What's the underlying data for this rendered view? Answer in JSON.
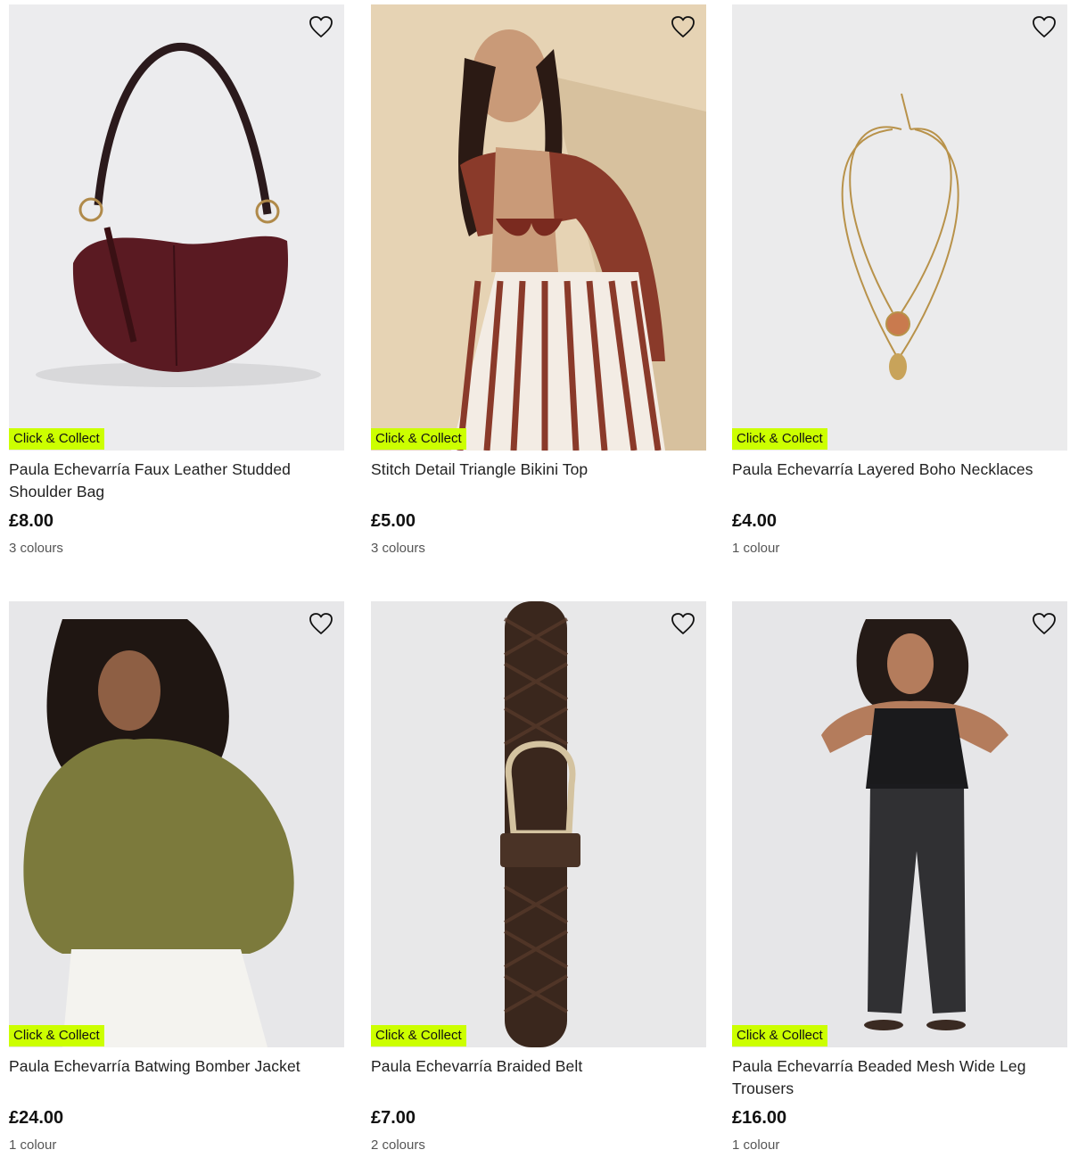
{
  "badge_color": "#ccff00",
  "heart_icon": "heart-outline-icon",
  "products": [
    {
      "badge": "Click & Collect",
      "title": "Paula Echevarría Faux Leather Studded Shoulder Bag",
      "price": "£8.00",
      "colours": "3 colours"
    },
    {
      "badge": "Click & Collect",
      "title": "Stitch Detail Triangle Bikini Top",
      "price": "£5.00",
      "colours": "3 colours"
    },
    {
      "badge": "Click & Collect",
      "title": "Paula Echevarría Layered Boho Necklaces",
      "price": "£4.00",
      "colours": "1 colour"
    },
    {
      "badge": "Click & Collect",
      "title": "Paula Echevarría Batwing Bomber Jacket",
      "price": "£24.00",
      "colours": "1 colour"
    },
    {
      "badge": "Click & Collect",
      "title": "Paula Echevarría Braided Belt",
      "price": "£7.00",
      "colours": "2 colours"
    },
    {
      "badge": "Click & Collect",
      "title": "Paula Echevarría Beaded Mesh Wide Leg Trousers",
      "price": "£16.00",
      "colours": "1 colour"
    }
  ]
}
